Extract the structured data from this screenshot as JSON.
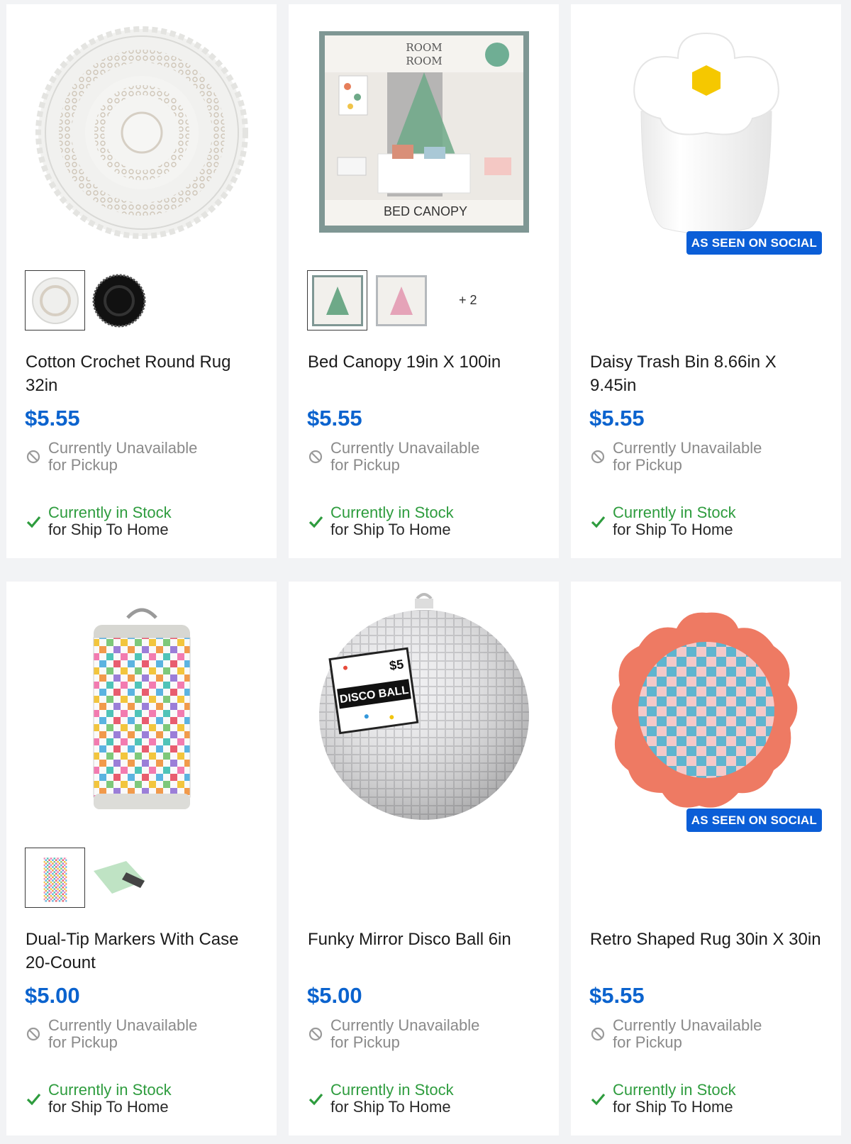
{
  "colors": {
    "price": "#0b63ce",
    "in_stock": "#2e9c3e",
    "unavailable": "#8a8a8a",
    "badge": "#0b5ed7"
  },
  "products": [
    {
      "title": "Cotton Crochet Round Rug 32in",
      "price": "$5.55",
      "image_icon": "crochet-rug-image",
      "swatches": [
        "white",
        "black"
      ],
      "more": "",
      "badge": "",
      "pickup_line1": "Currently Unavailable",
      "pickup_line2": "for Pickup",
      "ship_line1": "Currently in Stock",
      "ship_line2": "for Ship To Home"
    },
    {
      "title": "Bed Canopy 19in X 100in",
      "price": "$5.55",
      "image_icon": "bed-canopy-box-image",
      "swatches": [
        "green",
        "pink"
      ],
      "more": "+ 2",
      "badge": "",
      "pickup_line1": "Currently Unavailable",
      "pickup_line2": "for Pickup",
      "ship_line1": "Currently in Stock",
      "ship_line2": "for Ship To Home",
      "box_brand_line1": "ROOM",
      "box_brand_line2": "ROOM",
      "box_label": "BED CANOPY"
    },
    {
      "title": "Daisy Trash Bin 8.66in X 9.45in",
      "price": "$5.55",
      "image_icon": "daisy-trash-bin-image",
      "swatches": [],
      "more": "",
      "badge": "AS SEEN ON SOCIAL",
      "pickup_line1": "Currently Unavailable",
      "pickup_line2": "for Pickup",
      "ship_line1": "Currently in Stock",
      "ship_line2": "for Ship To Home"
    },
    {
      "title": "Dual-Tip Markers With Case 20-Count",
      "price": "$5.00",
      "image_icon": "marker-case-image",
      "swatches": [
        "checker",
        "green"
      ],
      "more": "",
      "badge": "",
      "pickup_line1": "Currently Unavailable",
      "pickup_line2": "for Pickup",
      "ship_line1": "Currently in Stock",
      "ship_line2": "for Ship To Home"
    },
    {
      "title": "Funky Mirror Disco Ball 6in",
      "price": "$5.00",
      "image_icon": "disco-ball-image",
      "swatches": [],
      "more": "",
      "badge": "",
      "pickup_line1": "Currently Unavailable",
      "pickup_line2": "for Pickup",
      "ship_line1": "Currently in Stock",
      "ship_line2": "for Ship To Home",
      "tag_price": "$5",
      "tag_label": "DISCO BALL"
    },
    {
      "title": "Retro Shaped Rug 30in X 30in",
      "price": "$5.55",
      "image_icon": "retro-rug-image",
      "swatches": [],
      "more": "",
      "badge": "AS SEEN ON SOCIAL",
      "pickup_line1": "Currently Unavailable",
      "pickup_line2": "for Pickup",
      "ship_line1": "Currently in Stock",
      "ship_line2": "for Ship To Home"
    }
  ]
}
